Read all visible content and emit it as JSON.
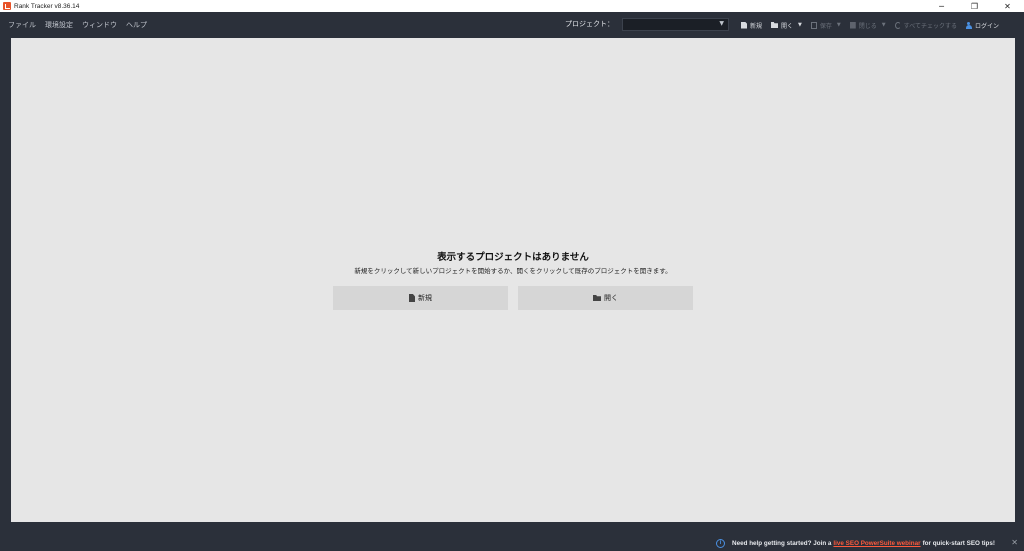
{
  "window": {
    "title": "Rank Tracker v8.36.14",
    "controls": {
      "minimize": "─",
      "restore": "❐",
      "close": "✕"
    }
  },
  "menu": [
    {
      "label": "ファイル"
    },
    {
      "label": "環境設定"
    },
    {
      "label": "ウィンドウ"
    },
    {
      "label": "ヘルプ"
    }
  ],
  "project": {
    "label": "プロジェクト：",
    "selected": ""
  },
  "toolbar": {
    "new_label": "新規",
    "open_label": "開く",
    "save_label": "保存",
    "close_label": "閉じる",
    "check_all_label": "すべてチェックする",
    "login_label": "ログイン"
  },
  "empty_state": {
    "title": "表示するプロジェクトはありません",
    "description": "新規をクリックして新しいプロジェクトを開始するか、開くをクリックして既存のプロジェクトを開きます。",
    "new_button": "新規",
    "open_button": "開く"
  },
  "notice": {
    "prefix": "Need help getting started? Join a",
    "link": "live SEO PowerSuite webinar",
    "suffix": "for quick-start SEO tips!",
    "info_glyph": "i",
    "close_glyph": "✕"
  },
  "colors": {
    "chrome_bg": "#2b303a",
    "main_bg": "#e6e6e6",
    "accent": "#4a90e2",
    "link": "#ff5a3c",
    "brand": "#e8542a"
  }
}
